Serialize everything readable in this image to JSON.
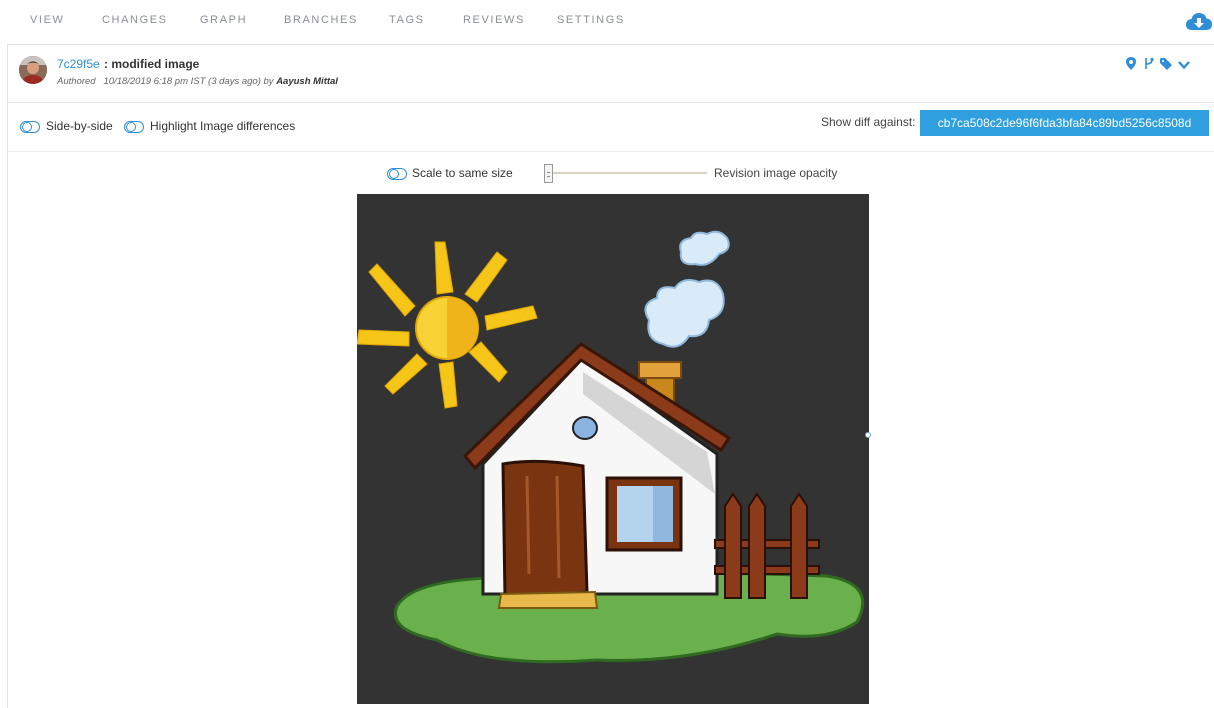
{
  "nav": {
    "tabs": [
      {
        "label": "VIEW"
      },
      {
        "label": "CHANGES"
      },
      {
        "label": "GRAPH"
      },
      {
        "label": "BRANCHES"
      },
      {
        "label": "TAGS"
      },
      {
        "label": "REVIEWS"
      },
      {
        "label": "SETTINGS"
      }
    ],
    "action_icon": "cloud-download-icon"
  },
  "commit": {
    "hash": "7c29f5e",
    "message": ": modified image",
    "authored_prefix": "Authored",
    "date": "10/18/2019 6:18 pm IST (3 days ago) by",
    "author": "Aayush Mittal",
    "icons": [
      "map-pin-icon",
      "branch-icon",
      "tag-icon",
      "chevron-down-icon"
    ]
  },
  "options": {
    "side_by_side": "Side-by-side",
    "highlight": "Highlight Image differences",
    "diff_label": "Show diff against:",
    "diff_commit": "cb7ca508c2de96f6fda3bfa84c89bd5256c8508d"
  },
  "image_controls": {
    "scale": "Scale to same size",
    "opacity_label": "Revision image opacity"
  },
  "colors": {
    "accent": "#2f9fe0",
    "link": "#2f8fd6",
    "canvas_bg": "#333333"
  }
}
